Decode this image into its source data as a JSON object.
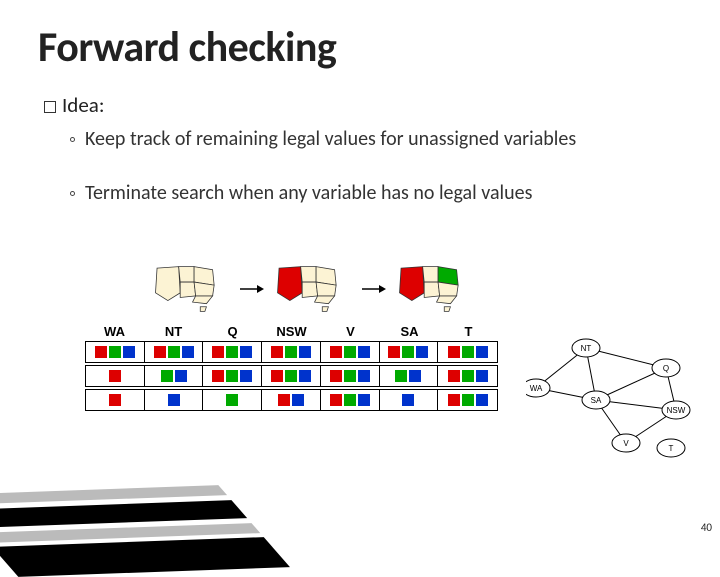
{
  "title": "Forward checking",
  "idea_label": "Idea",
  "sub_bullets": [
    "Keep track of remaining legal values for unassigned variables",
    "Terminate search when any variable has no legal values"
  ],
  "table": {
    "headers": [
      "WA",
      "NT",
      "Q",
      "NSW",
      "V",
      "SA",
      "T"
    ],
    "rows": [
      [
        [
          "r",
          "g",
          "b"
        ],
        [
          "r",
          "g",
          "b"
        ],
        [
          "r",
          "g",
          "b"
        ],
        [
          "r",
          "g",
          "b"
        ],
        [
          "r",
          "g",
          "b"
        ],
        [
          "r",
          "g",
          "b"
        ],
        [
          "r",
          "g",
          "b"
        ]
      ],
      [
        [
          "r"
        ],
        [
          "g",
          "b"
        ],
        [
          "r",
          "g",
          "b"
        ],
        [
          "r",
          "g",
          "b"
        ],
        [
          "r",
          "g",
          "b"
        ],
        [
          "g",
          "b"
        ],
        [
          "r",
          "g",
          "b"
        ]
      ],
      [
        [
          "r"
        ],
        [
          "b"
        ],
        [
          "g"
        ],
        [
          "r",
          "b"
        ],
        [
          "r",
          "g",
          "b"
        ],
        [
          "b"
        ],
        [
          "r",
          "g",
          "b"
        ]
      ]
    ]
  },
  "maps": [
    {
      "WA": "white",
      "NT": "white",
      "SA": "white",
      "Q": "white",
      "NSW": "white",
      "V": "white",
      "T": "white"
    },
    {
      "WA": "#d00",
      "NT": "white",
      "SA": "white",
      "Q": "white",
      "NSW": "white",
      "V": "white",
      "T": "white"
    },
    {
      "WA": "#d00",
      "NT": "white",
      "SA": "white",
      "Q": "#0a0",
      "NSW": "white",
      "V": "white",
      "T": "white"
    }
  ],
  "graph": {
    "nodes": [
      "WA",
      "NT",
      "Q",
      "NSW",
      "V",
      "SA",
      "T"
    ],
    "node_labels": {
      "WA": "WA",
      "NT": "NT",
      "Q": "Q",
      "NSW": "NSW",
      "V": "V",
      "SA": "SA",
      "T": "T"
    },
    "edges": [
      [
        "WA",
        "NT"
      ],
      [
        "WA",
        "SA"
      ],
      [
        "NT",
        "SA"
      ],
      [
        "NT",
        "Q"
      ],
      [
        "SA",
        "Q"
      ],
      [
        "SA",
        "NSW"
      ],
      [
        "SA",
        "V"
      ],
      [
        "Q",
        "NSW"
      ],
      [
        "NSW",
        "V"
      ]
    ]
  },
  "page_number": "40"
}
